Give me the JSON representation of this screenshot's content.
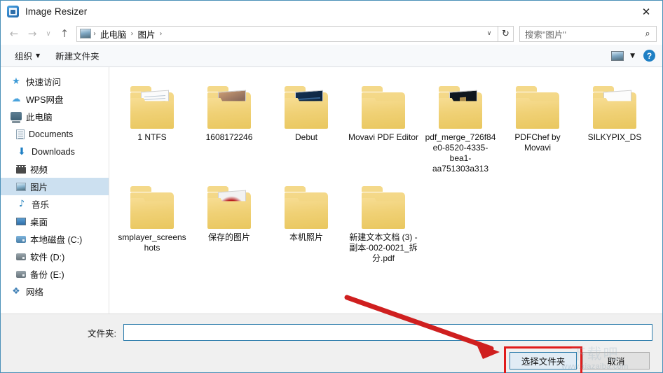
{
  "window": {
    "title": "Image Resizer",
    "app_icon": "image-resizer-icon",
    "close_label": "✕"
  },
  "nav": {
    "back": "←",
    "forward": "→",
    "recent": "∨",
    "up": "↑",
    "refresh": "↻",
    "dropdown": "∨",
    "breadcrumb": [
      {
        "label": "此电脑"
      },
      {
        "label": "图片"
      }
    ],
    "separator": "›"
  },
  "search": {
    "placeholder": "搜索\"图片\"",
    "icon": "⌕"
  },
  "toolbar": {
    "organize_label": "组织",
    "organize_caret": "▼",
    "new_folder_label": "新建文件夹",
    "view_caret": "▼",
    "help_label": "?"
  },
  "sidebar": {
    "items": [
      {
        "label": "快速访问",
        "icon": "star-icon",
        "glyph": "★",
        "icon_class": "ico-star",
        "indent": false,
        "selected": false
      },
      {
        "label": "WPS网盘",
        "icon": "cloud-icon",
        "glyph": "☁",
        "icon_class": "ico-cloud",
        "indent": false,
        "selected": false
      },
      {
        "label": "此电脑",
        "icon": "this-pc-icon",
        "glyph": "",
        "icon_class": "ico-pc",
        "indent": false,
        "selected": false
      },
      {
        "label": "Documents",
        "icon": "documents-icon",
        "glyph": "",
        "icon_class": "ico-doc",
        "indent": true,
        "selected": false
      },
      {
        "label": "Downloads",
        "icon": "downloads-icon",
        "glyph": "⬇",
        "icon_class": "ico-down",
        "indent": true,
        "selected": false
      },
      {
        "label": "视频",
        "icon": "videos-icon",
        "glyph": "",
        "icon_class": "ico-video",
        "indent": true,
        "selected": false
      },
      {
        "label": "图片",
        "icon": "pictures-icon",
        "glyph": "",
        "icon_class": "ico-pic",
        "indent": true,
        "selected": true
      },
      {
        "label": "音乐",
        "icon": "music-icon",
        "glyph": "♪",
        "icon_class": "ico-music",
        "indent": true,
        "selected": false
      },
      {
        "label": "桌面",
        "icon": "desktop-icon",
        "glyph": "",
        "icon_class": "ico-desk",
        "indent": true,
        "selected": false
      },
      {
        "label": "本地磁盘 (C:)",
        "icon": "drive-icon",
        "glyph": "",
        "icon_class": "ico-drive sys",
        "indent": true,
        "selected": false
      },
      {
        "label": "软件 (D:)",
        "icon": "drive-icon",
        "glyph": "",
        "icon_class": "ico-drive",
        "indent": true,
        "selected": false
      },
      {
        "label": "备份 (E:)",
        "icon": "drive-icon",
        "glyph": "",
        "icon_class": "ico-drive",
        "indent": true,
        "selected": false
      },
      {
        "label": "网络",
        "icon": "network-icon",
        "glyph": "❖",
        "icon_class": "ico-net",
        "indent": false,
        "selected": false
      }
    ]
  },
  "files": {
    "items": [
      {
        "name": "1 NTFS",
        "thumb": "s-lines"
      },
      {
        "name": "1608172246",
        "thumb": "s-photo"
      },
      {
        "name": "Debut",
        "thumb": "s-blue"
      },
      {
        "name": "Movavi PDF Editor",
        "thumb": ""
      },
      {
        "name": "pdf_merge_726f84e0-8520-4335-bea1-aa751303a313",
        "thumb": "s-dark"
      },
      {
        "name": "PDFChef by Movavi",
        "thumb": ""
      },
      {
        "name": "SILKYPIX_DS",
        "thumb": "s-silky"
      },
      {
        "name": "smplayer_screenshots",
        "thumb": ""
      },
      {
        "name": "保存的图片",
        "thumb": "s-berry"
      },
      {
        "name": "本机照片",
        "thumb": ""
      },
      {
        "name": "新建文本文档 (3) - 副本-002-0021_拆分.pdf",
        "thumb": ""
      }
    ]
  },
  "footer": {
    "folder_label": "文件夹:",
    "folder_value": "",
    "folder_placeholder": "",
    "select_button": "选择文件夹",
    "cancel_button": "取消"
  },
  "annotations": {
    "highlight_color": "#e01b1b",
    "arrow_color": "#cf1f1f",
    "watermark_mark": "下载吧",
    "watermark_url": "www.xiazaiba.com"
  }
}
